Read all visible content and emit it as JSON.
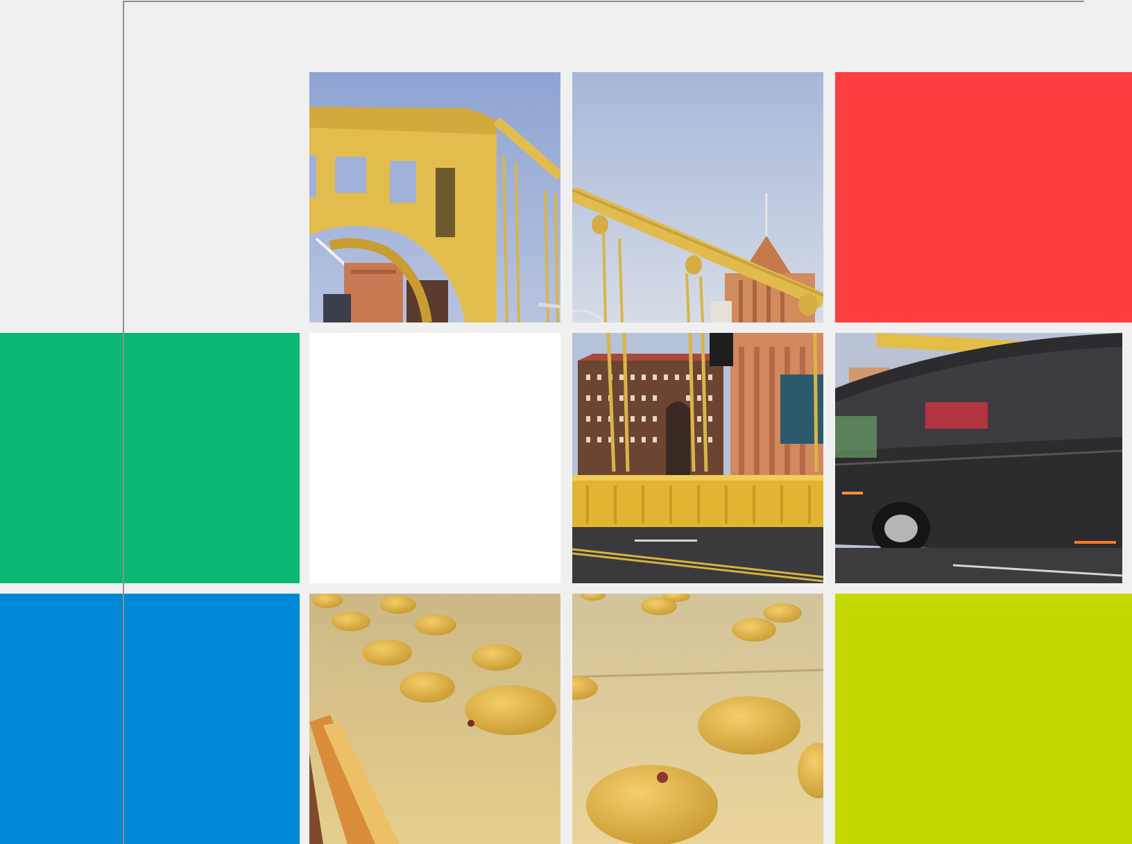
{
  "colors": {
    "background": "#f0f0f0",
    "guide_line": "#8f8f8f",
    "tile_red": "#ff3e40",
    "tile_green": "#0bb873",
    "tile_blue": "#0089d6",
    "tile_lime": "#c4d900",
    "tile_white": "#ffffff",
    "bridge_yellow": "#e3bf4f",
    "sky": "#a9b9dc"
  },
  "tiles": [
    {
      "kind": "photo",
      "subject": "bridge-arch"
    },
    {
      "kind": "photo",
      "subject": "bridge-cables-skyline"
    },
    {
      "kind": "solid",
      "color": "red"
    },
    {
      "kind": "solid",
      "color": "green"
    },
    {
      "kind": "solid",
      "color": "white"
    },
    {
      "kind": "photo",
      "subject": "bridge-deck-buildings"
    },
    {
      "kind": "photo",
      "subject": "moving-bus"
    },
    {
      "kind": "solid",
      "color": "blue"
    },
    {
      "kind": "photo",
      "subject": "bridge-rivets-left"
    },
    {
      "kind": "photo",
      "subject": "bridge-rivets-right"
    },
    {
      "kind": "solid",
      "color": "lime"
    }
  ]
}
